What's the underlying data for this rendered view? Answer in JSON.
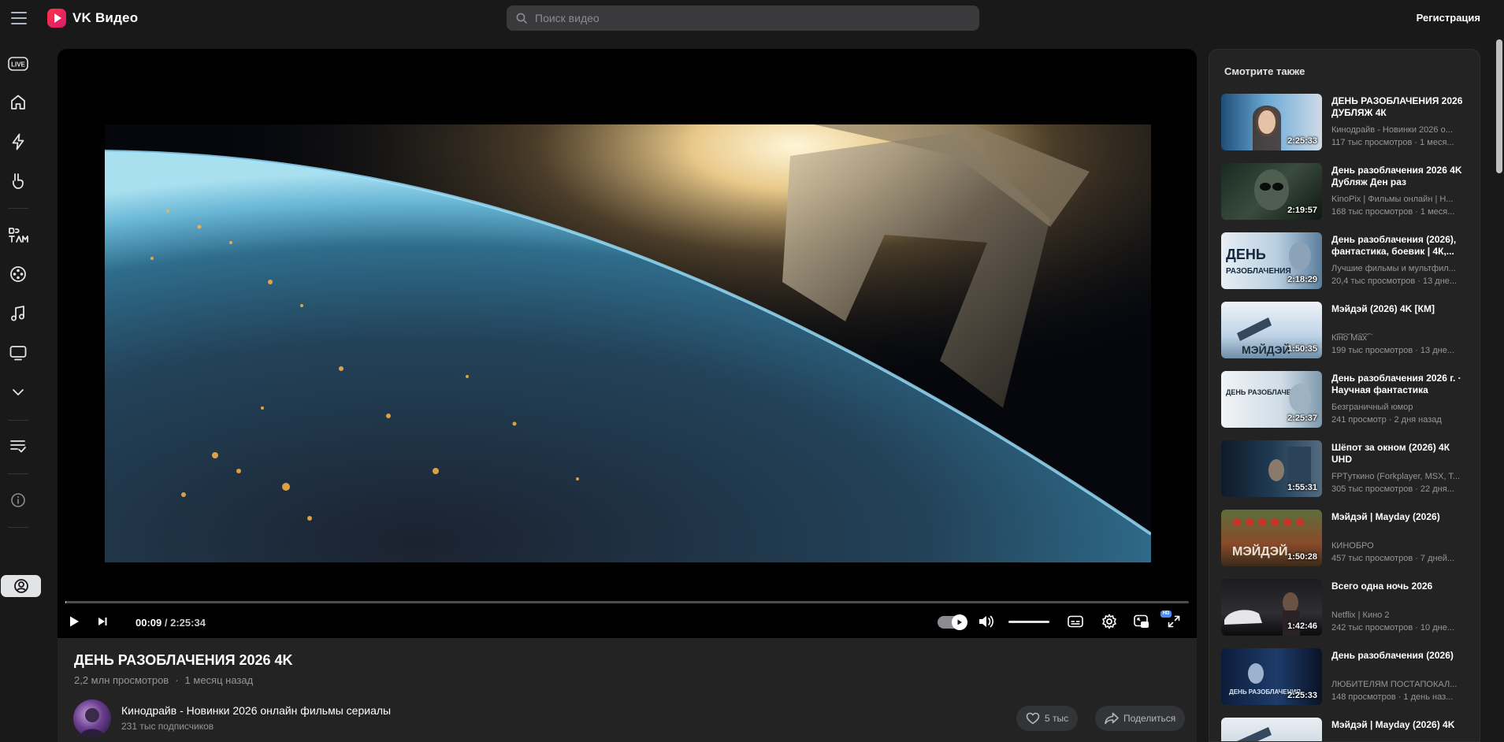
{
  "app": {
    "name": "VK Видео"
  },
  "header": {
    "search_placeholder": "Поиск видео",
    "register_label": "Регистрация"
  },
  "nav": [
    {
      "id": "live",
      "icon": "live-icon"
    },
    {
      "id": "home",
      "icon": "home-icon"
    },
    {
      "id": "shorts",
      "icon": "lightning-icon"
    },
    {
      "id": "kids-clips",
      "icon": "hand-icon"
    },
    {
      "id": "kids",
      "icon": "detyam-icon"
    },
    {
      "id": "movies",
      "icon": "film-reel-icon"
    },
    {
      "id": "music",
      "icon": "music-icon"
    },
    {
      "id": "tv",
      "icon": "tv-icon"
    },
    {
      "id": "more",
      "icon": "chevron-down-icon"
    },
    {
      "id": "playlists",
      "icon": "playlist-icon"
    },
    {
      "id": "about",
      "icon": "info-icon"
    },
    {
      "id": "profile",
      "icon": "profile-icon"
    }
  ],
  "nav_live_label": "LIVE",
  "player": {
    "current_time": "00:09",
    "separator": "/",
    "total_time": "2:25:34",
    "progress": 0.001,
    "hd_badge": "HD"
  },
  "video": {
    "title": "ДЕНЬ РАЗОБЛАЧЕНИЯ 2026 4K",
    "views": "2,2 млн просмотров",
    "dot": "·",
    "date": "1 месяц назад",
    "channel": "Кинодрайв - Новинки 2026 онлайн фильмы сериалы",
    "subscribers": "231 тыс подписчиков",
    "likes": "5 тыс",
    "share_label": "Поделиться"
  },
  "sidebar": {
    "title": "Смотрите также",
    "items": [
      {
        "title": "ДЕНЬ РАЗОБЛАЧЕНИЯ 2026 ДУБЛЯЖ 4К",
        "channel": "Кинодрайв - Новинки 2026 о...",
        "meta": "117 тыс просмотров · 1 меся...",
        "duration": "2:25:33"
      },
      {
        "title": "День разоблачения 2026 4K Дубляж Ден раз",
        "channel": "KinoPix | Фильмы онлайн | Н...",
        "meta": "168 тыс просмотров · 1 меся...",
        "duration": "2:19:57"
      },
      {
        "title": "День разоблачения (2026), фантастика, боевик | 4К,...",
        "channel": "Лучшие фильмы и мультфил...",
        "meta": "20,4 тыс просмотров · 13 дне...",
        "duration": "2:18:29"
      },
      {
        "title": "Мэйдэй (2026) 4K [КМ]",
        "channel": "К͡і͡н͡о͡ М͡а͡х͡",
        "meta": "199 тыс просмотров · 13 дне...",
        "duration": "1:50:35"
      },
      {
        "title": "День разоблачения 2026 г. · Научная фантастика",
        "channel": "Безграничный юмор",
        "meta": "241 просмотр · 2 дня назад",
        "duration": "2:25:37"
      },
      {
        "title": "Шёпот за окном (2026) 4К UHD",
        "channel": "FPTуткино (Forkplayer, MSX, T...",
        "meta": "305 тыс просмотров · 22 дня...",
        "duration": "1:55:31"
      },
      {
        "title": "Мэйдэй | Mayday (2026)",
        "channel": "КИНОБРО",
        "meta": "457 тыс просмотров · 7 дней...",
        "duration": "1:50:28"
      },
      {
        "title": "Всего одна ночь 2026",
        "channel": "Netflix | Кино 2",
        "meta": "242 тыс просмотров · 10 дне...",
        "duration": "1:42:46"
      },
      {
        "title": "День разоблачения (2026)",
        "channel": "ЛЮБИТЕЛЯМ ПОСТАПОКАЛ...",
        "meta": "148 просмотров · 1 день наз...",
        "duration": "2:25:33"
      },
      {
        "title": "Мэйдэй | Mayday (2026) 4K",
        "channel": "",
        "meta": "",
        "duration": ""
      }
    ]
  },
  "colors": {
    "background": "#19191a",
    "panel": "#232324",
    "accent": "#ff3347",
    "text": "#e1e3e6",
    "muted": "#939699"
  }
}
